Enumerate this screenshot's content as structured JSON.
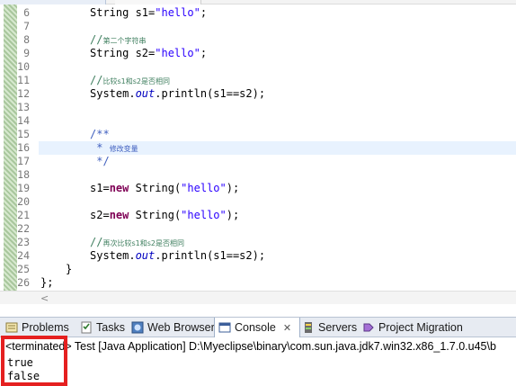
{
  "editor": {
    "lines": [
      {
        "n": "6",
        "tokens": [
          [
            "",
            "String s1="
          ],
          [
            "str",
            "\"hello\""
          ],
          [
            "",
            ";"
          ]
        ],
        "indent": 2
      },
      {
        "n": "7",
        "tokens": [],
        "indent": 0
      },
      {
        "n": "8",
        "tokens": [
          [
            "cmt",
            "//"
          ],
          [
            "cmt cjk",
            "第二个字符串"
          ]
        ],
        "indent": 2
      },
      {
        "n": "9",
        "tokens": [
          [
            "",
            "String s2="
          ],
          [
            "str",
            "\"hello\""
          ],
          [
            "",
            ";"
          ]
        ],
        "indent": 2
      },
      {
        "n": "10",
        "tokens": [],
        "indent": 0
      },
      {
        "n": "11",
        "tokens": [
          [
            "cmt",
            "//"
          ],
          [
            "cmt cjk",
            "比较s1和s2是否相同"
          ]
        ],
        "indent": 2
      },
      {
        "n": "12",
        "tokens": [
          [
            "",
            "System."
          ],
          [
            "stat",
            "out"
          ],
          [
            "",
            ".println(s1==s2);"
          ]
        ],
        "indent": 2
      },
      {
        "n": "13",
        "tokens": [],
        "indent": 0
      },
      {
        "n": "14",
        "tokens": [],
        "indent": 0
      },
      {
        "n": "15",
        "tokens": [
          [
            "doc",
            "/**"
          ]
        ],
        "indent": 2
      },
      {
        "n": "16",
        "tokens": [
          [
            "doc",
            " * "
          ],
          [
            "doc cjk",
            "修改变量"
          ]
        ],
        "indent": 2,
        "current": true
      },
      {
        "n": "17",
        "tokens": [
          [
            "doc",
            " */"
          ]
        ],
        "indent": 2
      },
      {
        "n": "18",
        "tokens": [],
        "indent": 0
      },
      {
        "n": "19",
        "tokens": [
          [
            "",
            "s1="
          ],
          [
            "kw",
            "new"
          ],
          [
            "",
            " String("
          ],
          [
            "str",
            "\"hello\""
          ],
          [
            "",
            ");"
          ]
        ],
        "indent": 2
      },
      {
        "n": "20",
        "tokens": [],
        "indent": 0
      },
      {
        "n": "21",
        "tokens": [
          [
            "",
            "s2="
          ],
          [
            "kw",
            "new"
          ],
          [
            "",
            " String("
          ],
          [
            "str",
            "\"hello\""
          ],
          [
            "",
            ");"
          ]
        ],
        "indent": 2
      },
      {
        "n": "22",
        "tokens": [],
        "indent": 0
      },
      {
        "n": "23",
        "tokens": [
          [
            "cmt",
            "//"
          ],
          [
            "cmt cjk",
            "再次比较s1和s2是否相同"
          ]
        ],
        "indent": 2
      },
      {
        "n": "24",
        "tokens": [
          [
            "",
            "System."
          ],
          [
            "stat",
            "out"
          ],
          [
            "",
            ".println(s1==s2);"
          ]
        ],
        "indent": 2
      },
      {
        "n": "25",
        "tokens": [
          [
            "",
            "}"
          ]
        ],
        "indent": 1
      },
      {
        "n": "26",
        "tokens": [
          [
            "",
            "};"
          ]
        ],
        "indent": 0
      }
    ],
    "scroll_left_glyph": "<"
  },
  "views": {
    "tabs": [
      {
        "label": "Problems",
        "icon": "problems-icon",
        "active": false
      },
      {
        "label": "Tasks",
        "icon": "tasks-icon",
        "active": false
      },
      {
        "label": "Web Browser",
        "icon": "web-browser-icon",
        "active": false
      },
      {
        "label": "Console",
        "icon": "console-icon",
        "active": true,
        "close": "✕"
      },
      {
        "label": "Servers",
        "icon": "servers-icon",
        "active": false
      },
      {
        "label": "Project Migration",
        "icon": "project-migration-icon",
        "active": false
      }
    ]
  },
  "console": {
    "header": "<terminated> Test [Java Application] D:\\Myeclipse\\binary\\com.sun.java.jdk7.win32.x86_1.7.0.u45\\b",
    "output": [
      "true",
      "false"
    ]
  },
  "colors": {
    "highlight": "#e52020",
    "keyword": "#7f0055",
    "string": "#2a00ff",
    "comment": "#3f7f5f",
    "javadoc": "#3f5fbf",
    "static_field": "#0000c0"
  }
}
